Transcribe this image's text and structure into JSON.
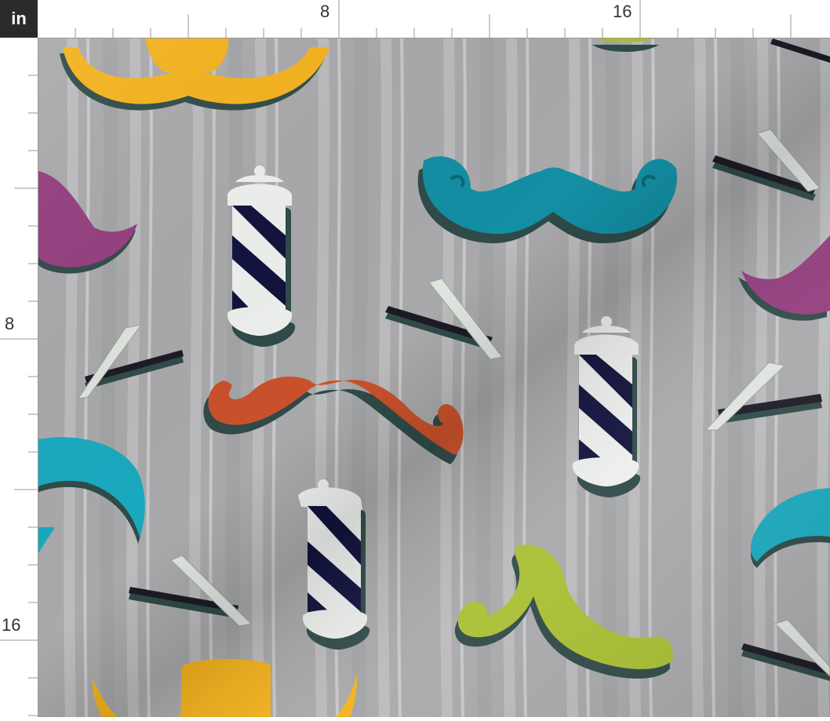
{
  "ruler": {
    "unit_label": "in",
    "top_labels": [
      "8",
      "16"
    ],
    "left_labels": [
      "8",
      "16"
    ]
  },
  "fabric": {
    "background_color": "#a9a9ab",
    "stripe_light_color": "#c3c4c6",
    "stripe_dark_color": "#9c9da0",
    "motif_colors": {
      "mustache_yellow": "#f4b21c",
      "mustache_teal": "#138ea3",
      "mustache_orange": "#c9512b",
      "mustache_green": "#a9bf33",
      "mustache_magenta": "#943d7e",
      "mustache_cyan": "#1aa9bf",
      "pole_stripe": "#11123d",
      "pole_white": "#eef0ee",
      "razor_handle": "#1b1b25",
      "shadow": "#2f4a48"
    }
  }
}
